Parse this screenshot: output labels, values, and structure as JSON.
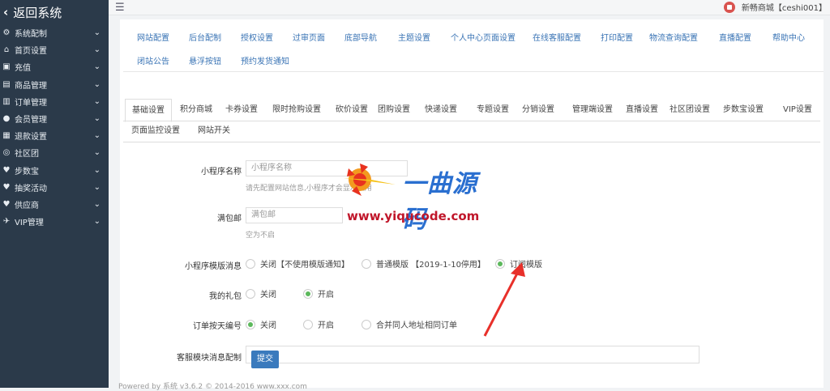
{
  "sidebar": {
    "back_label": "返回系统",
    "items": [
      {
        "icon": "gear-icon",
        "glyph": "⚙",
        "label": "系统配制"
      },
      {
        "icon": "home-icon",
        "glyph": "⌂",
        "label": "首页设置"
      },
      {
        "icon": "recharge-icon",
        "glyph": "▣",
        "label": "充值"
      },
      {
        "icon": "goods-icon",
        "glyph": "▤",
        "label": "商品管理"
      },
      {
        "icon": "order-icon",
        "glyph": "▥",
        "label": "订单管理"
      },
      {
        "icon": "members-icon",
        "glyph": "●",
        "label": "会员管理"
      },
      {
        "icon": "refund-icon",
        "glyph": "▦",
        "label": "退款设置"
      },
      {
        "icon": "community-icon",
        "glyph": "◎",
        "label": "社区团"
      },
      {
        "icon": "heart-icon",
        "glyph": "♥",
        "label": "步数宝"
      },
      {
        "icon": "heart-icon",
        "glyph": "♥",
        "label": "抽奖活动"
      },
      {
        "icon": "heart-icon",
        "glyph": "♥",
        "label": "供应商"
      },
      {
        "icon": "plane-icon",
        "glyph": "✈",
        "label": "VIP管理"
      }
    ]
  },
  "topbar": {
    "user_label": "新畅商城【ceshi001】"
  },
  "tabs_primary": [
    "网站配置",
    "后台配制",
    "授权设置",
    "过审页面",
    "底部导航",
    "主题设置",
    "个人中心页面设置",
    "在线客服配置",
    "打印配置",
    "物流查询配置",
    "直播配置",
    "帮助中心",
    "闭站公告",
    "悬浮按钮",
    "预约发货通知"
  ],
  "tabs_secondary": [
    "基础设置",
    "积分商城",
    "卡券设置",
    "限时抢购设置",
    "砍价设置",
    "团购设置",
    "快递设置",
    "专题设置",
    "分销设置",
    "管理端设置",
    "直播设置",
    "社区团设置",
    "步数宝设置",
    "VIP设置",
    "页面监控设置",
    "网站开关"
  ],
  "form": {
    "mini_name_label": "小程序名称",
    "mini_name_placeholder": "小程序名称",
    "mini_name_help": "请先配置网站信息,小程序才会显示应用",
    "free_ship_label": "满包邮",
    "free_ship_placeholder": "满包邮",
    "free_ship_help": "空为不启",
    "template_label": "小程序模版消息",
    "template_options": [
      "关闭【不使用模版通知】",
      "普通模版 【2019-1-10停用】",
      "订阅模版"
    ],
    "template_selected": 2,
    "gift_label": "我的礼包",
    "gift_options": [
      "关闭",
      "开启"
    ],
    "gift_selected": 1,
    "order_label": "订单按天编号",
    "order_options": [
      "关闭",
      "开启",
      "合并同人地址相同订单"
    ],
    "order_selected": 0,
    "service_label": "客服模块消息配制",
    "submit_label": "提交"
  },
  "footer_text": "Powered by 系统 v3.6.2 © 2014-2016 www.xxx.com",
  "watermark": {
    "title": "一曲源码",
    "url": "www.yiqucode.com"
  },
  "colors": {
    "sidebar_bg": "#2b3a4a",
    "link": "#3a74b5",
    "radio_on": "#5cb85c",
    "button": "#3a7abd",
    "arrow": "#e8302a"
  }
}
